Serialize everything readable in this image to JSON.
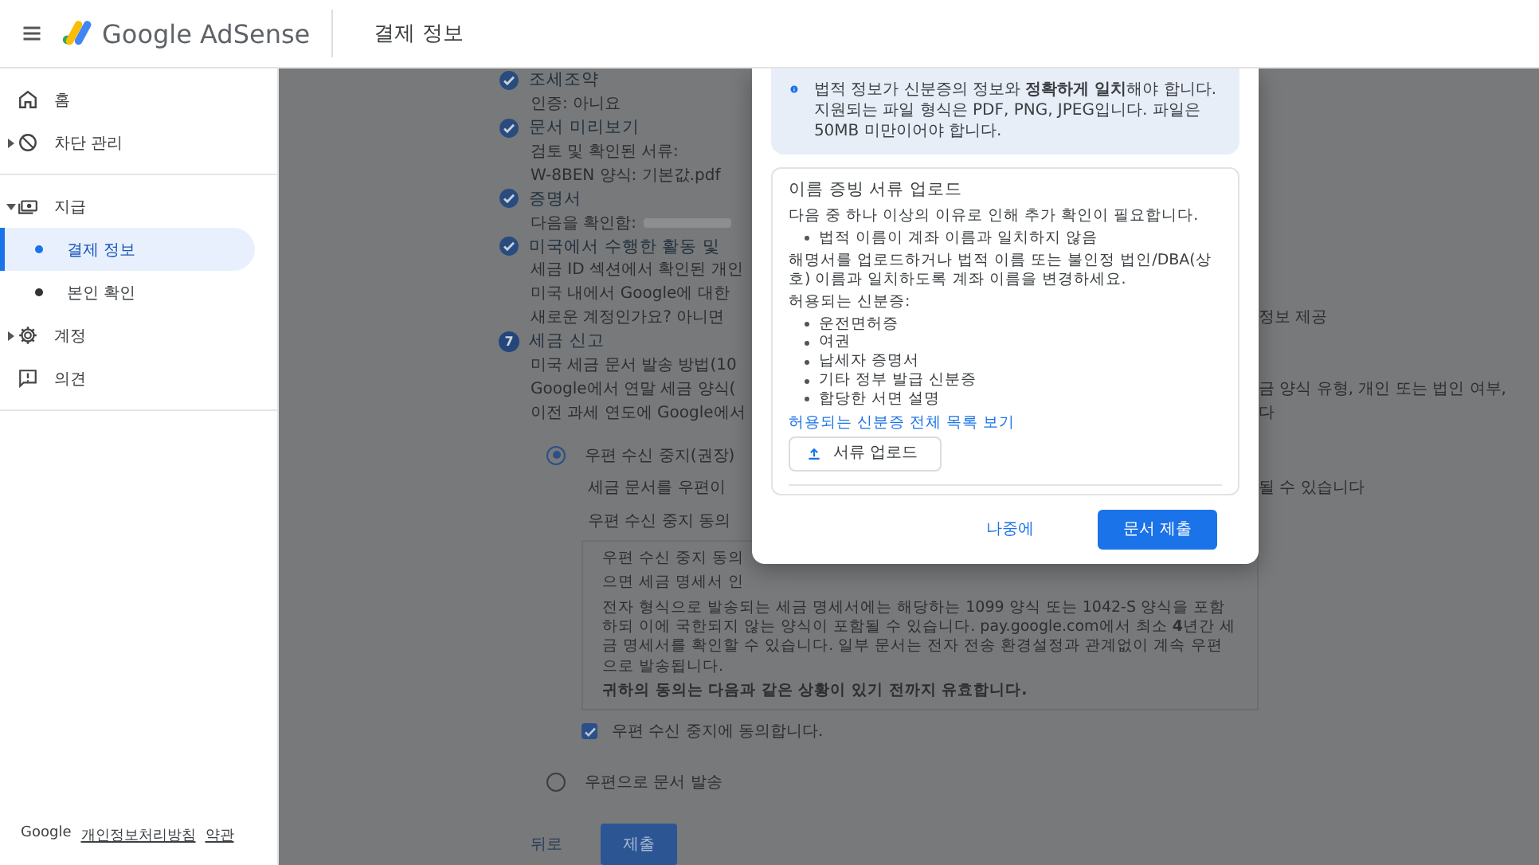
{
  "header": {
    "product": "Google AdSense",
    "page_title": "결제 정보"
  },
  "sidebar": {
    "sections": [
      {
        "items": [
          {
            "label": "홈",
            "kind": "home"
          },
          {
            "label": "차단 관리",
            "kind": "block",
            "expanded": false
          }
        ]
      },
      {
        "items": [
          {
            "label": "지급",
            "kind": "payments",
            "expanded": true,
            "children": [
              {
                "label": "결제 정보",
                "selected": true
              },
              {
                "label": "본인 확인",
                "selected": false
              }
            ]
          },
          {
            "label": "계정",
            "kind": "settings",
            "expanded": false
          },
          {
            "label": "의견",
            "kind": "feedback"
          }
        ]
      }
    ],
    "footer": {
      "brand": "Google",
      "links": [
        "개인정보처리방침",
        "약관"
      ]
    }
  },
  "steps": [
    {
      "kind": "done",
      "title": "조세조약",
      "lines": [
        {
          "text": "인증: 아니요"
        }
      ]
    },
    {
      "kind": "done",
      "title": "문서 미리보기",
      "lines": [
        {
          "text": "검토 및 확인된 서류:"
        },
        {
          "text": "W-8BEN 양식: 기본값.pdf"
        }
      ]
    },
    {
      "kind": "done",
      "title": "증명서",
      "lines": [
        {
          "text": "다음을 확인함:",
          "redacted": true
        }
      ]
    },
    {
      "kind": "done",
      "title": "미국에서 수행한 활동 및",
      "lines": [
        {
          "text": "세금 ID 섹션에서 확인된 개인"
        },
        {
          "text": "미국 내에서 Google에 대한"
        },
        {
          "text": "새로운 계정인가요? 아니면",
          "tail": "정보 제공"
        }
      ]
    },
    {
      "kind": "current",
      "number": "7",
      "title": "세금 신고",
      "lines": [
        {
          "text": "미국 세금 문서 발송 방법(10"
        },
        {
          "text": "Google에서 연말 세금 양식(",
          "tail": "금 양식 유형, 개인 또는 법인 여부,"
        },
        {
          "text": "이전 과세 연도에 Google에서",
          "tail": "다"
        }
      ]
    }
  ],
  "delivery_options": [
    {
      "label": "우편 수신 중지(권장)",
      "selected": true,
      "description": {
        "text": "세금 문서를 우편이",
        "tail": "될 수 있습니다"
      },
      "consent": {
        "heading": "우편 수신 중지 동의",
        "box_lines": [
          "우편 수신 중지 동의",
          "으면 세금 명세서 인"
        ],
        "paragraph": "전자 형식으로 발송되는 세금 명세서에는 해당하는 1099 양식 또는 1042-S 양식을 포함하되 이에 국한되지 않는 양식이 포함될 수 있습니다. pay.google.com에서 최소 **4**년간 세금 명세서를 확인할 수 있습니다. 일부 문서는 전자 전송 환경설정과 관계없이 계속 우편으로 발송됩니다.",
        "note": "귀하의 동의는 다음과 같은 상황이 있기 전까지 유효합니다.",
        "checkbox": {
          "label": "우편 수신 중지에 동의합니다.",
          "checked": true
        }
      }
    },
    {
      "label": "우편으로 문서 발송",
      "selected": false
    }
  ],
  "actions": {
    "back": "뒤로",
    "submit": "제출"
  },
  "modal": {
    "info": "법적 정보가 신분증의 정보와 **정확하게 일치**해야 합니다. 지원되는 파일 형식은 PDF, PNG, JPEG입니다. 파일은 50MB 미만이어야 합니다.",
    "card": {
      "title": "이름 증빙 서류 업로드",
      "intro": "다음 중 하나 이상의 이유로 인해 추가 확인이 필요합니다.",
      "reasons": [
        "법적 이름이 계좌 이름과 일치하지 않음"
      ],
      "instruction": "해명서를 업로드하거나 법적 이름 또는 불인정 법인/DBA(상호) 이름과 일치하도록 계좌 이름을 변경하세요.",
      "accepted_label": "허용되는 신분증:",
      "accepted": [
        "운전면허증",
        "여권",
        "납세자 증명서",
        "기타 정부 발급 신분증",
        "합당한 서면 설명"
      ],
      "link": "허용되는 신분증 전체 목록 보기",
      "upload_button": "서류 업로드"
    },
    "later_button": "나중에",
    "submit_button": "문서 제출"
  }
}
